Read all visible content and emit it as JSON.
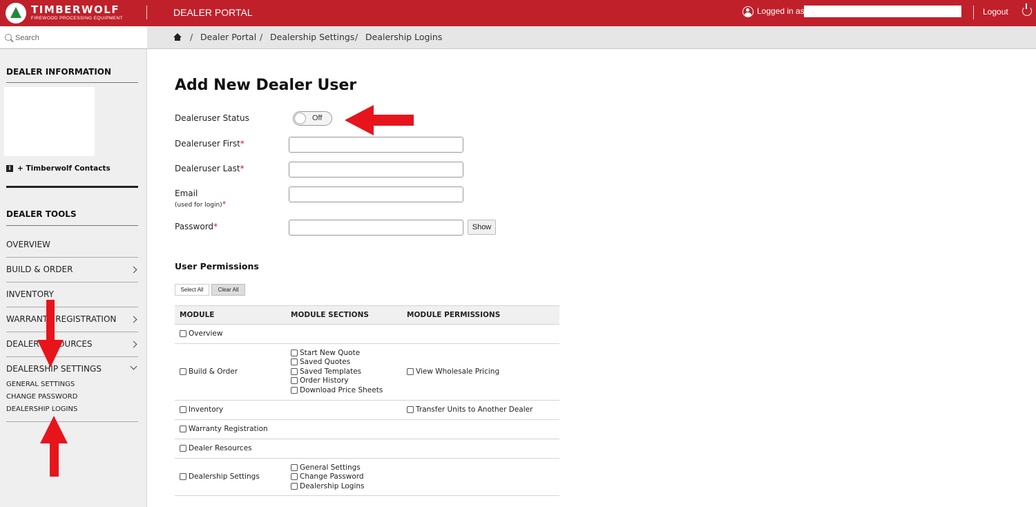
{
  "header": {
    "logo_name": "TIMBERWOLF",
    "logo_tagline": "FIREWOOD PROCESSING EQUIPMENT",
    "portal_title": "DEALER PORTAL",
    "logged_in_label": "Logged in as",
    "logout_label": "Logout",
    "brand_color": "#c0202a"
  },
  "search": {
    "placeholder": "Search"
  },
  "breadcrumb": [
    "Dealer Portal",
    "Dealership Settings",
    "Dealership Logins"
  ],
  "sidebar": {
    "dealer_info_heading": "DEALER INFORMATION",
    "contacts_link": "+ Timberwolf Contacts",
    "tools_heading": "DEALER TOOLS",
    "nav": [
      {
        "label": "OVERVIEW"
      },
      {
        "label": "BUILD & ORDER"
      },
      {
        "label": "INVENTORY"
      },
      {
        "label": "WARRANTY REGISTRATION"
      },
      {
        "label": "DEALER RESOURCES"
      },
      {
        "label": "DEALERSHIP SETTINGS"
      }
    ],
    "sub_links": [
      "GENERAL SETTINGS",
      "CHANGE PASSWORD",
      "DEALERSHIP LOGINS"
    ]
  },
  "form": {
    "title": "Add New Dealer User",
    "status_label": "Dealeruser Status",
    "status_value": "Off",
    "first_label": "Dealeruser First",
    "last_label": "Dealeruser Last",
    "email_label": "Email",
    "email_sub": "(used for login)",
    "password_label": "Password",
    "required_mark": "*",
    "show_button": "Show"
  },
  "permissions": {
    "title": "User Permissions",
    "select_all": "Select All",
    "clear_all": "Clear All",
    "headers": [
      "MODULE",
      "MODULE SECTIONS",
      "MODULE PERMISSIONS"
    ],
    "rows": [
      {
        "module": "Overview",
        "sections": [],
        "permissions": []
      },
      {
        "module": "Build & Order",
        "sections": [
          "Start New Quote",
          "Saved Quotes",
          "Saved Templates",
          "Order History",
          "Download Price Sheets"
        ],
        "permissions": [
          "View Wholesale Pricing"
        ]
      },
      {
        "module": "Inventory",
        "sections": [],
        "permissions": [
          "Transfer Units to Another Dealer"
        ]
      },
      {
        "module": "Warranty Registration",
        "sections": [],
        "permissions": []
      },
      {
        "module": "Dealer Resources",
        "sections": [],
        "permissions": []
      },
      {
        "module": "Dealership Settings",
        "sections": [
          "General Settings",
          "Change Password",
          "Dealership Logins"
        ],
        "permissions": []
      }
    ]
  },
  "annotations": {
    "arrow_color": "#e8141c"
  }
}
